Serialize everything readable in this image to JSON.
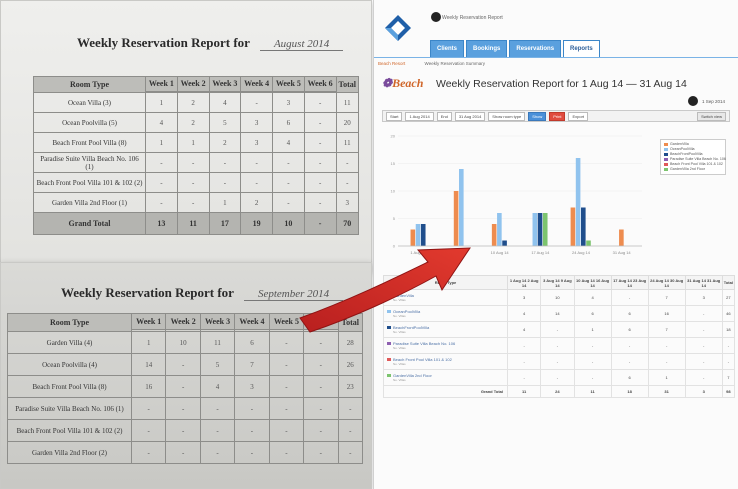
{
  "paper": {
    "sheet1": {
      "title": "Weekly Reservation Report for",
      "handwritten_month": "August 2014",
      "headers": [
        "Room Type",
        "Week 1",
        "Week 2",
        "Week 3",
        "Week 4",
        "Week 5",
        "Week 6",
        "Total"
      ],
      "rows": [
        {
          "room": "Ocean Villa (3)",
          "values": [
            "1",
            "2",
            "4",
            "-",
            "3",
            "-",
            "11"
          ]
        },
        {
          "room": "Ocean Poolvilla (5)",
          "values": [
            "4",
            "2",
            "5",
            "3",
            "6",
            "-",
            "20"
          ]
        },
        {
          "room": "Beach Front Pool Villa (8)",
          "values": [
            "1",
            "1",
            "2",
            "3",
            "4",
            "-",
            "11"
          ]
        },
        {
          "room": "Paradise Suite Villa Beach No. 106 (1)",
          "values": [
            "-",
            "-",
            "-",
            "-",
            "-",
            "-",
            "-"
          ]
        },
        {
          "room": "Beach Front Pool Villa 101 & 102 (2)",
          "values": [
            "-",
            "-",
            "-",
            "-",
            "-",
            "-",
            "-"
          ]
        },
        {
          "room": "Garden Villa 2nd Floor (1)",
          "values": [
            "-",
            "-",
            "1",
            "2",
            "-",
            "-",
            "3"
          ]
        }
      ],
      "grand_total": {
        "label": "Grand Total",
        "values": [
          "13",
          "11",
          "17",
          "19",
          "10",
          "-",
          "70"
        ]
      }
    },
    "sheet2": {
      "title": "Weekly Reservation Report for",
      "handwritten_month": "September 2014",
      "headers": [
        "Room Type",
        "Week 1",
        "Week 2",
        "Week 3",
        "Week 4",
        "Week 5",
        "Week 6",
        "Total"
      ],
      "rows": [
        {
          "room": "Garden Villa (4)",
          "values": [
            "1",
            "10",
            "11",
            "6",
            "-",
            "-",
            "28"
          ]
        },
        {
          "room": "Ocean Poolvilla (4)",
          "values": [
            "14",
            "-",
            "5",
            "7",
            "-",
            "-",
            "26"
          ]
        },
        {
          "room": "Beach Front Pool Villa (8)",
          "values": [
            "16",
            "-",
            "4",
            "3",
            "-",
            "-",
            "23"
          ]
        },
        {
          "room": "Paradise Suite Villa Beach No. 106 (1)",
          "values": [
            "-",
            "-",
            "-",
            "-",
            "-",
            "-",
            "-"
          ]
        },
        {
          "room": "Beach Front Pool Villa 101 & 102 (2)",
          "values": [
            "-",
            "-",
            "-",
            "-",
            "-",
            "-",
            "-"
          ]
        },
        {
          "room": "Garden Villa 2nd Floor (2)",
          "values": [
            "-",
            "-",
            "-",
            "-",
            "-",
            "-",
            "-"
          ]
        }
      ]
    }
  },
  "screen": {
    "topbar_text": "Weekly Reservation Report",
    "topbar_right": "",
    "logo_sub": "",
    "nav_tabs": [
      "Clients",
      "Bookings",
      "Reservations",
      "Reports"
    ],
    "nav_right": "",
    "breadcrumb": [
      "Beach Resort",
      "Weekly Reservation Summary"
    ],
    "brand": "Beach",
    "report_title": "Weekly Reservation Report for 1 Aug 14 — 31 Aug 14",
    "date_right": "1 Sep 2014",
    "filters": {
      "from_label": "Start",
      "from_value": "1 Aug 2014",
      "to_label": "End",
      "to_value": "31 Aug 2014",
      "select_label": "Show room type",
      "buttons": [
        "Show",
        "Print",
        "Export"
      ],
      "right_button": "Switch view"
    },
    "colors": {
      "accent": "#5aa0de",
      "brand_orange": "#d0662a",
      "arrow_red": "#d72a2a"
    },
    "table": {
      "headers": [
        "Room Type",
        "1 Aug 14 2 Aug 14",
        "3 Aug 14 9 Aug 14",
        "10 Aug 14 16 Aug 14",
        "17 Aug 14 23 Aug 14",
        "24 Aug 14 30 Aug 14",
        "31 Aug 14 31 Aug 14",
        "Total"
      ],
      "rows": [
        {
          "name": "GardenVilla",
          "sub": "No. Villas",
          "color": "#ee8c4f",
          "values": [
            "3",
            "10",
            "4",
            "-",
            "7",
            "3",
            "27"
          ]
        },
        {
          "name": "OceanPoolVilla",
          "sub": "No. Villas",
          "color": "#90c3ee",
          "values": [
            "4",
            "14",
            "6",
            "6",
            "16",
            "-",
            "46"
          ]
        },
        {
          "name": "BeachFrontPoolVilla",
          "sub": "No. Villas",
          "color": "#1f4e8c",
          "values": [
            "4",
            "-",
            "1",
            "6",
            "7",
            "-",
            "18"
          ]
        },
        {
          "name": "Paradise Suite Villa Beach No. 106",
          "sub": "No. Villas",
          "color": "#8e5fb0",
          "values": [
            "-",
            "-",
            "-",
            "-",
            "-",
            "-",
            "-"
          ]
        },
        {
          "name": "Beach Front Pool Villa 101 & 102",
          "sub": "No. Villas",
          "color": "#e05a5a",
          "values": [
            "-",
            "-",
            "-",
            "-",
            "-",
            "-",
            "-"
          ]
        },
        {
          "name": "GardenVilla 2nd Floor",
          "sub": "No. Villas",
          "color": "#7cc46e",
          "values": [
            "-",
            "-",
            "-",
            "6",
            "1",
            "-",
            "7"
          ]
        }
      ],
      "total": {
        "label": "Grand Total",
        "values": [
          "11",
          "24",
          "11",
          "18",
          "31",
          "3",
          "98"
        ]
      }
    },
    "footer": ""
  },
  "chart_data": {
    "type": "bar",
    "title": "",
    "xlabel": "",
    "ylabel": "",
    "categories": [
      "1 Aug 14",
      "3 Aug 14",
      "10 Aug 14",
      "17 Aug 14",
      "24 Aug 14",
      "31 Aug 14"
    ],
    "ylim": [
      0,
      20
    ],
    "yticks": [
      0,
      5,
      10,
      15,
      20
    ],
    "grid": true,
    "legend": "right",
    "series": [
      {
        "name": "GardenVilla",
        "color": "#ee8c4f",
        "values": [
          3,
          10,
          4,
          0,
          7,
          3
        ]
      },
      {
        "name": "OceanPoolVilla",
        "color": "#90c3ee",
        "values": [
          4,
          14,
          6,
          6,
          16,
          0
        ]
      },
      {
        "name": "BeachFrontPoolVilla",
        "color": "#1f4e8c",
        "values": [
          4,
          0,
          1,
          6,
          7,
          0
        ]
      },
      {
        "name": "Paradise Suite Villa Beach No. 106",
        "color": "#8e5fb0",
        "values": [
          0,
          0,
          0,
          0,
          0,
          0
        ]
      },
      {
        "name": "Beach Front Pool Villa 101 & 102",
        "color": "#e05a5a",
        "values": [
          0,
          0,
          0,
          0,
          0,
          0
        ]
      },
      {
        "name": "GardenVilla 2nd Floor",
        "color": "#7cc46e",
        "values": [
          0,
          0,
          0,
          6,
          1,
          0
        ]
      }
    ]
  }
}
